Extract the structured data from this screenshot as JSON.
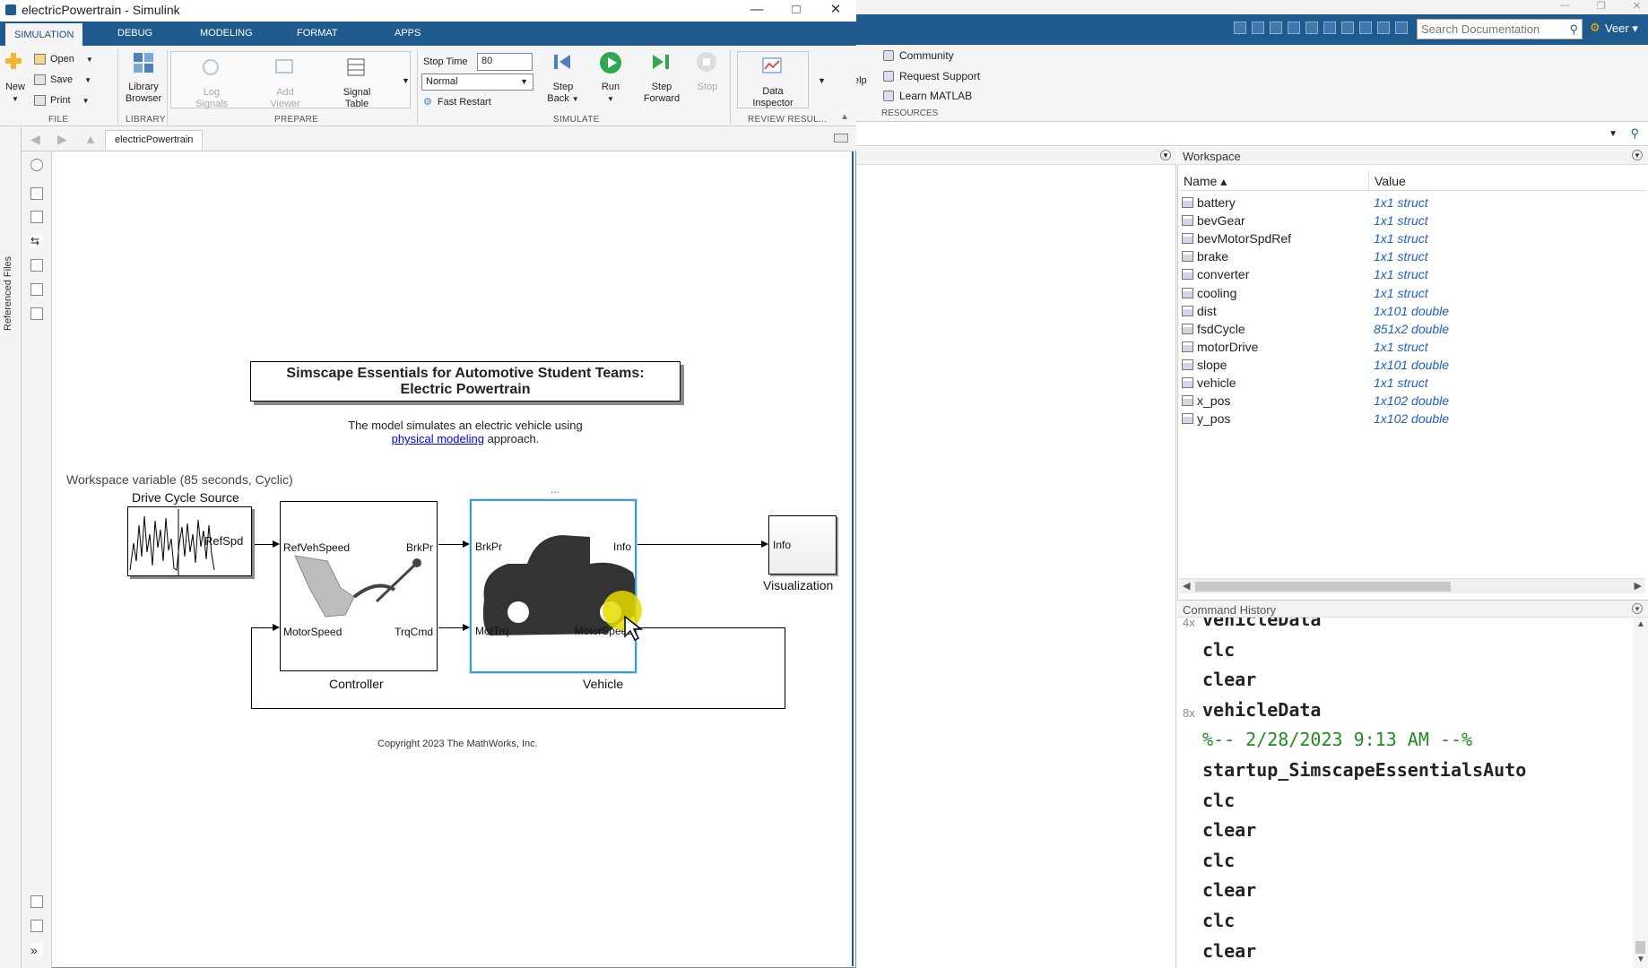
{
  "simulink": {
    "title": "electricPowertrain - Simulink",
    "tabs": [
      "SIMULATION",
      "DEBUG",
      "MODELING",
      "FORMAT",
      "APPS"
    ],
    "file": {
      "new": "New",
      "open": "Open",
      "save": "Save",
      "print": "Print",
      "section": "FILE"
    },
    "library": {
      "browser_line1": "Library",
      "browser_line2": "Browser",
      "section": "LIBRARY"
    },
    "prepare": {
      "log_line1": "Log",
      "log_line2": "Signals",
      "viewer_line1": "Add",
      "viewer_line2": "Viewer",
      "signal_line1": "Signal",
      "signal_line2": "Table",
      "section": "PREPARE"
    },
    "simulate": {
      "stop_time_label": "Stop Time",
      "stop_time_value": "80",
      "mode": "Normal",
      "fast_restart": "Fast Restart",
      "step_back_1": "Step",
      "step_back_2": "Back",
      "run": "Run",
      "step_fwd_1": "Step",
      "step_fwd_2": "Forward",
      "stop": "Stop",
      "section": "SIMULATE"
    },
    "review": {
      "di_line1": "Data",
      "di_line2": "Inspector",
      "section": "REVIEW RESUL..."
    },
    "breadcrumb": "electricPowertrain",
    "referenced_files": "Referenced Files",
    "model": {
      "title_line1": "Simscape Essentials for Automotive Student Teams:",
      "title_line2": "Electric Powertrain",
      "desc_line1": "The model simulates an electric vehicle using",
      "desc_link": "physical modeling",
      "desc_rest": " approach.",
      "ws_var": "Workspace variable (85  seconds, Cyclic)",
      "drive_cycle_label": "Drive Cycle Source",
      "drive_cycle_port": "RefSpd",
      "controller_label": "Controller",
      "ctrl_in1": "RefVehSpeed",
      "ctrl_in2": "MotorSpeed",
      "ctrl_out1": "BrkPr",
      "ctrl_out2": "TrqCmd",
      "vehicle_label": "Vehicle",
      "veh_in1": "BrkPr",
      "veh_in2": "MotTrq",
      "veh_out1": "Info",
      "veh_out2": "MotorSpeed",
      "vis_label": "Visualization",
      "vis_port": "Info",
      "ellipsis": "...",
      "copyright": "Copyright 2023 The MathWorks, Inc."
    }
  },
  "matlab": {
    "search_placeholder": "Search Documentation",
    "user": "Veer",
    "resources": {
      "community": "Community",
      "support": "Request Support",
      "learn": "Learn MATLAB",
      "section": "RESOURCES",
      "help_frag": "elp"
    },
    "workspace": {
      "title": "Workspace",
      "col_name": "Name ▴",
      "col_value": "Value",
      "rows": [
        {
          "name": "battery",
          "value": "1x1 struct"
        },
        {
          "name": "bevGear",
          "value": "1x1 struct"
        },
        {
          "name": "bevMotorSpdRef",
          "value": "1x1 struct"
        },
        {
          "name": "brake",
          "value": "1x1 struct"
        },
        {
          "name": "converter",
          "value": "1x1 struct"
        },
        {
          "name": "cooling",
          "value": "1x1 struct"
        },
        {
          "name": "dist",
          "value": "1x101 double"
        },
        {
          "name": "fsdCycle",
          "value": "851x2 double"
        },
        {
          "name": "motorDrive",
          "value": "1x1 struct"
        },
        {
          "name": "slope",
          "value": "1x101 double"
        },
        {
          "name": "vehicle",
          "value": "1x1 struct"
        },
        {
          "name": "x_pos",
          "value": "1x102 double"
        },
        {
          "name": "y_pos",
          "value": "1x102 double"
        }
      ]
    },
    "history": {
      "title": "Command History",
      "lines": [
        {
          "count": "4x",
          "text": "vehicleData",
          "comment": false
        },
        {
          "count": "",
          "text": "clc",
          "comment": false
        },
        {
          "count": "",
          "text": "clear",
          "comment": false
        },
        {
          "count": "8x",
          "text": "vehicleData",
          "comment": false
        },
        {
          "count": "",
          "text": "%-- 2/28/2023 9:13 AM --%",
          "comment": true
        },
        {
          "count": "",
          "text": "startup_SimscapeEssentialsAuto",
          "comment": false
        },
        {
          "count": "",
          "text": "clc",
          "comment": false
        },
        {
          "count": "",
          "text": "clear",
          "comment": false
        },
        {
          "count": "",
          "text": "clc",
          "comment": false
        },
        {
          "count": "",
          "text": "clear",
          "comment": false
        },
        {
          "count": "",
          "text": "clc",
          "comment": false
        },
        {
          "count": "",
          "text": "clear",
          "comment": false
        }
      ]
    }
  }
}
